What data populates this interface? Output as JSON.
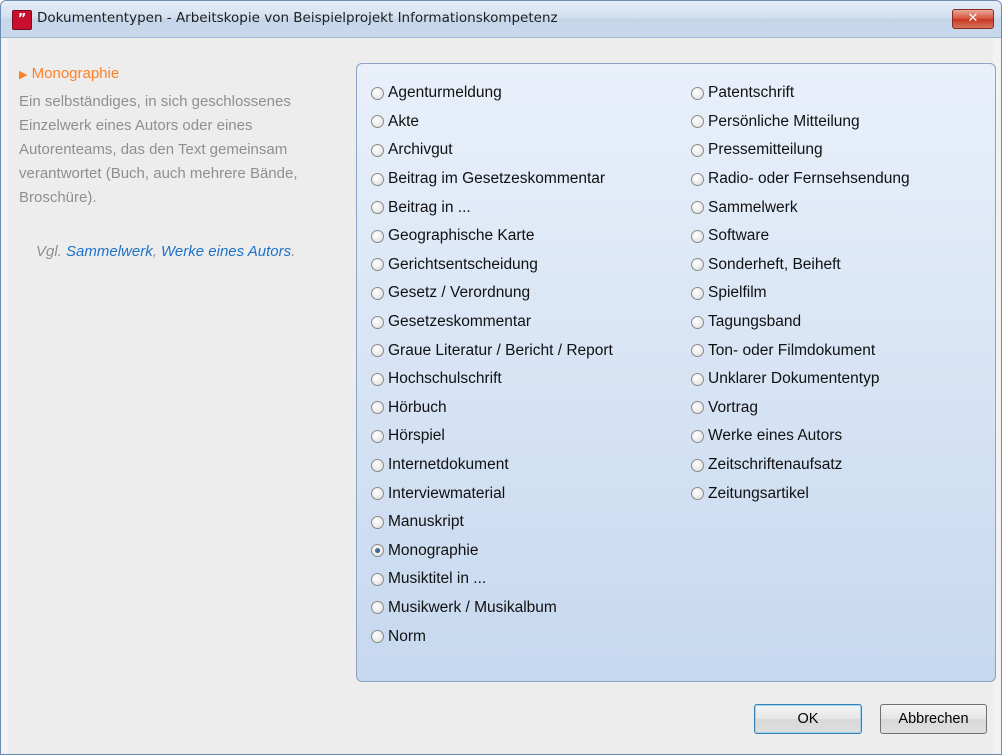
{
  "window": {
    "title": "Dokumententypen - Arbeitskopie von Beispielprojekt Informationskompetenz",
    "app_icon_glyph": "”",
    "close_glyph": "✕"
  },
  "detail": {
    "heading_marker": "▶",
    "heading": "Monographie",
    "description": "Ein selbständiges, in sich geschlossenes Einzelwerk eines Autors oder eines Autorenteams, das den Text gemeinsam verantwortet (Buch, auch mehrere Bände, Broschüre).",
    "see_also_prefix": "Vgl. ",
    "see_also_links": [
      "Sammelwerk",
      "Werke eines Autors"
    ],
    "see_also_separator": ", ",
    "see_also_suffix": "."
  },
  "options": {
    "column1": [
      {
        "label": "Agenturmeldung",
        "checked": false
      },
      {
        "label": "Akte",
        "checked": false
      },
      {
        "label": "Archivgut",
        "checked": false
      },
      {
        "label": "Beitrag im Gesetzeskommentar",
        "checked": false
      },
      {
        "label": "Beitrag in ...",
        "checked": false
      },
      {
        "label": "Geographische Karte",
        "checked": false
      },
      {
        "label": "Gerichtsentscheidung",
        "checked": false
      },
      {
        "label": "Gesetz / Verordnung",
        "checked": false
      },
      {
        "label": "Gesetzeskommentar",
        "checked": false
      },
      {
        "label": "Graue Literatur / Bericht / Report",
        "checked": false
      },
      {
        "label": "Hochschulschrift",
        "checked": false
      },
      {
        "label": "Hörbuch",
        "checked": false
      },
      {
        "label": "Hörspiel",
        "checked": false
      },
      {
        "label": "Internetdokument",
        "checked": false
      },
      {
        "label": "Interviewmaterial",
        "checked": false
      },
      {
        "label": "Manuskript",
        "checked": false
      },
      {
        "label": "Monographie",
        "checked": true
      },
      {
        "label": "Musiktitel in ...",
        "checked": false
      },
      {
        "label": "Musikwerk / Musikalbum",
        "checked": false
      },
      {
        "label": "Norm",
        "checked": false
      }
    ],
    "column2": [
      {
        "label": "Patentschrift",
        "checked": false
      },
      {
        "label": "Persönliche Mitteilung",
        "checked": false
      },
      {
        "label": "Pressemitteilung",
        "checked": false
      },
      {
        "label": "Radio- oder Fernsehsendung",
        "checked": false
      },
      {
        "label": "Sammelwerk",
        "checked": false
      },
      {
        "label": "Software",
        "checked": false
      },
      {
        "label": "Sonderheft, Beiheft",
        "checked": false
      },
      {
        "label": "Spielfilm",
        "checked": false
      },
      {
        "label": "Tagungsband",
        "checked": false
      },
      {
        "label": "Ton- oder Filmdokument",
        "checked": false
      },
      {
        "label": "Unklarer Dokumententyp",
        "checked": false
      },
      {
        "label": "Vortrag",
        "checked": false
      },
      {
        "label": "Werke eines Autors",
        "checked": false
      },
      {
        "label": "Zeitschriftenaufsatz",
        "checked": false
      },
      {
        "label": "Zeitungsartikel",
        "checked": false
      }
    ]
  },
  "buttons": {
    "ok": "OK",
    "cancel": "Abbrechen"
  },
  "colors": {
    "heading_accent": "#ff7f27",
    "link": "#1e73c8",
    "description_text": "#8f8f8f"
  }
}
